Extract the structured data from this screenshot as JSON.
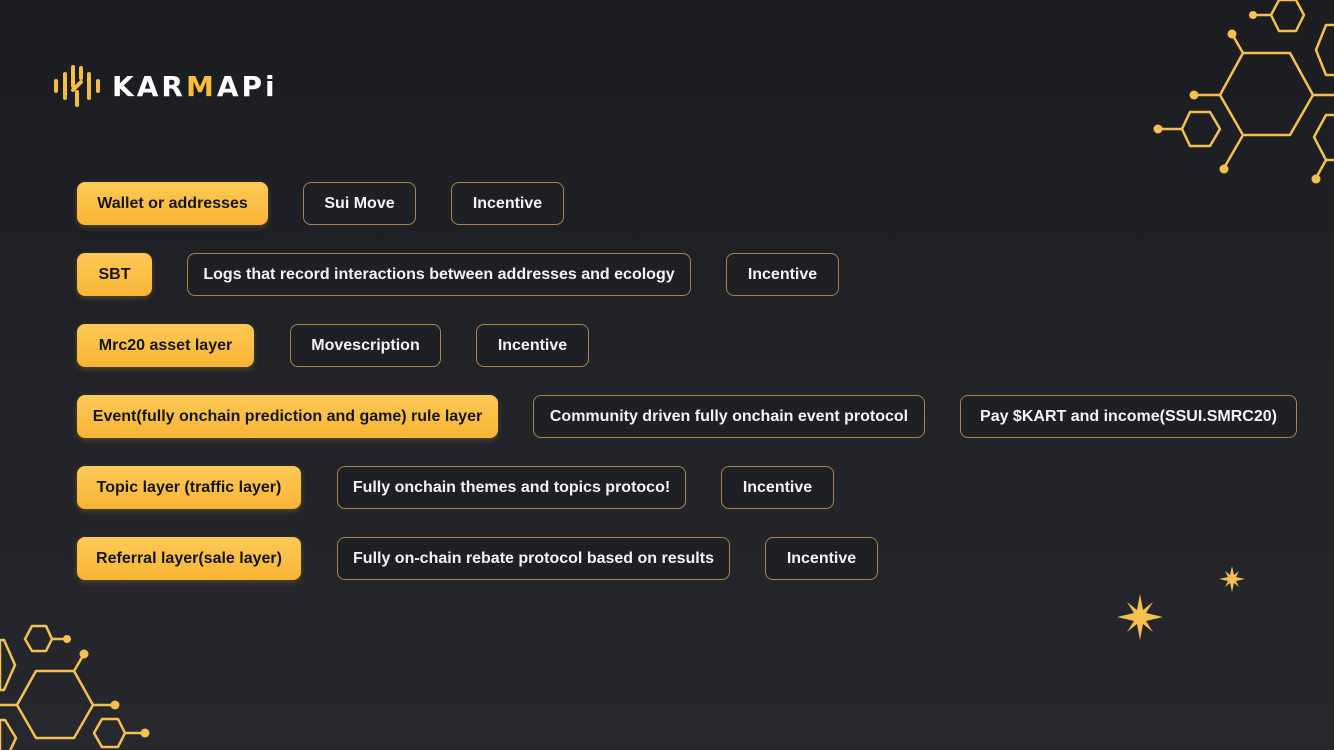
{
  "brand": {
    "name_prefix": "KAR",
    "name_accent": "M",
    "name_suffix": "APi",
    "accent_color": "#f9bd3e"
  },
  "colors": {
    "background": "#1e2025",
    "primary_pill": "#fbbf45",
    "outline_border": "#a8844a",
    "decoration": "#f5c04f"
  },
  "rows": [
    {
      "layer": "Wallet or addresses",
      "items": [
        "Sui Move",
        "Incentive"
      ]
    },
    {
      "layer": "SBT",
      "items": [
        "Logs that record interactions between addresses and ecology",
        "Incentive"
      ]
    },
    {
      "layer": "Mrc20 asset layer",
      "items": [
        "Movescription",
        "Incentive"
      ]
    },
    {
      "layer": "Event(fully onchain prediction and game) rule layer",
      "items": [
        "Community driven fully onchain event protocol",
        "Pay $KART and income(SSUI.SMRC20)"
      ]
    },
    {
      "layer": "Topic layer (traffic layer)",
      "items": [
        "Fully onchain themes and topics protoco!",
        "Incentive"
      ]
    },
    {
      "layer": "Referral layer(sale layer)",
      "items": [
        "Fully on-chain rebate protocol based on results",
        "Incentive"
      ]
    }
  ],
  "decorations": [
    "hexagon-network-top-right",
    "hexagon-network-bottom-left",
    "sparkle-large",
    "sparkle-small"
  ]
}
